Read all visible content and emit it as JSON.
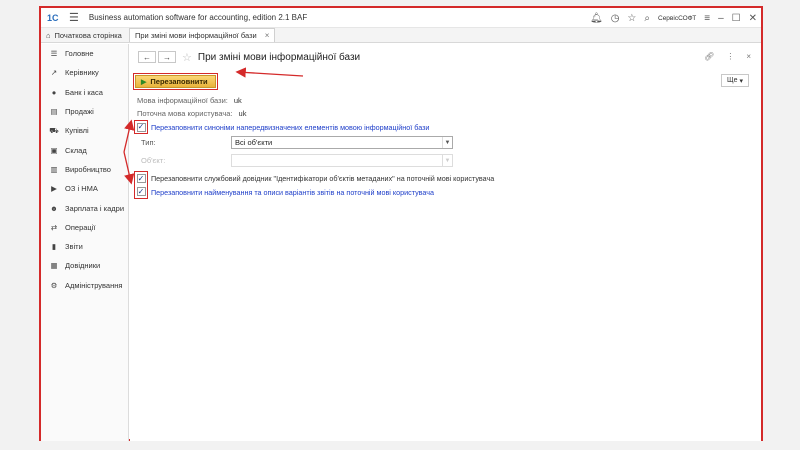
{
  "titlebar": {
    "logo": "1С",
    "title": "Business automation software for accounting, edition 2.1 BAF",
    "user": "СервісСОФТ"
  },
  "tabs": {
    "home": "Початкова сторінка",
    "active": "При зміні мови інформаційної бази"
  },
  "sidebar": {
    "items": [
      {
        "label": "Головне",
        "icon": "menu-icon"
      },
      {
        "label": "Керівнику",
        "icon": "chart-line-icon"
      },
      {
        "label": "Банк і каса",
        "icon": "coins-icon"
      },
      {
        "label": "Продажі",
        "icon": "store-icon"
      },
      {
        "label": "Купівлі",
        "icon": "cart-icon"
      },
      {
        "label": "Склад",
        "icon": "box-icon"
      },
      {
        "label": "Виробництво",
        "icon": "factory-icon"
      },
      {
        "label": "ОЗ і НМА",
        "icon": "truck-icon"
      },
      {
        "label": "Зарплата і кадри",
        "icon": "people-icon"
      },
      {
        "label": "Операції",
        "icon": "operations-icon"
      },
      {
        "label": "Звіти",
        "icon": "bar-chart-icon"
      },
      {
        "label": "Довідники",
        "icon": "book-icon"
      },
      {
        "label": "Адміністрування",
        "icon": "gear-icon"
      }
    ]
  },
  "form": {
    "title": "При зміні мови інформаційної бази",
    "fill_button": "Перезаповнити",
    "more_button": "Ще",
    "base_lang_label": "Мова інформаційної бази:",
    "base_lang_value": "uk",
    "user_lang_label": "Поточна мова користувача:",
    "user_lang_value": "uk",
    "check1_label": "Перезаповнити синоніми напередвизначених елементів мовою інформаційної бази",
    "check1_checked": true,
    "type_label": "Тип:",
    "type_value": "Всі об'єкти",
    "object_label": "Об'єкт:",
    "object_value": "",
    "check2_label": "Перезаповнити службовий довідник \"Ідентифікатори об'єктів метаданих\" на поточній мові користувача",
    "check2_checked": true,
    "check3_label": "Перезаповнити найменування та описи варіантів звітів на поточній мові користувача",
    "check3_checked": true
  },
  "colors": {
    "annotation_red": "#d42a2a",
    "link_blue": "#1e3ec9",
    "button_yellow": "#f2c34e"
  }
}
